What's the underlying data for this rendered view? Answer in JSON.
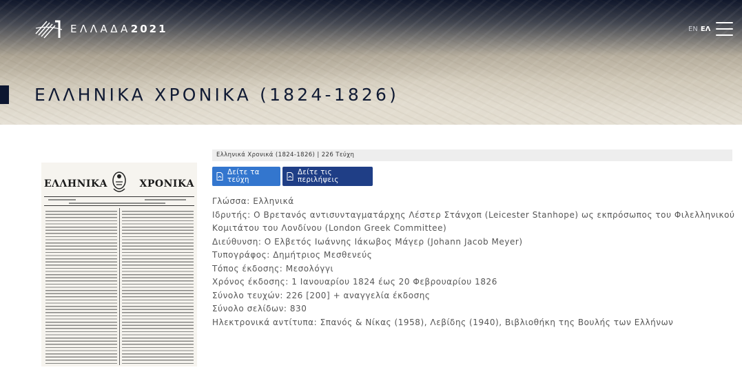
{
  "header": {
    "logo_text": "ΕΛΛΑΔΑ",
    "logo_year": "2021",
    "lang_en": "EN",
    "lang_el": "ΕΛ",
    "menu_icon": "hamburger-icon"
  },
  "page": {
    "title": "ΕΛΛΗΝΙΚΑ ΧΡΟΝΙΚΑ (1824-1826)"
  },
  "newspaper": {
    "masthead_left": "ΕΛΛΗΝΙΚΑ",
    "masthead_right": "ΧΡΟΝΙΚΑ",
    "emblem_icon": "crest-icon"
  },
  "breadcrumb": "Ελληνικά Χρονικά (1824-1826) | 226 Τεύχη",
  "buttons": {
    "issues": "Δείτε τα τεύχη",
    "summaries": "Δείτε τις περιλήψεις",
    "icon": "pdf-file-icon"
  },
  "details": [
    "Γλώσσα: Ελληνικά",
    "Ιδρυτής: Ο Βρετανός αντισυνταγματάρχης Λέστερ Στάνχοπ (Leicester Stanhope) ως εκπρόσωπος του Φιλελληνικού",
    "Κομιτάτου του Λονδίνου (London Greek Committee)",
    "Διεύθυνση: Ο Ελβετός Ιωάννης Ιάκωβος Μάγερ (Johann Jacob Meyer)",
    "Τυπογράφος: Δημήτριος Μεσθενεύς",
    "Τόπος έκδοσης: Μεσολόγγι",
    "Χρόνος έκδοσης: 1 Ιανουαρίου 1824 έως 20 Φεβρουαρίου 1826",
    "Σύνολο τευχών: 226 [200] + αναγγελία έκδοσης",
    "Σύνολο σελίδων: 830",
    "Ηλεκτρονικά αντίτυπα: Σπανός & Νίκας (1958), Λεβίδης (1940), Βιβλιοθήκη της Βουλής των Ελλήνων"
  ],
  "colors": {
    "primary_button": "#3376ce",
    "secondary_button": "#1f3e86",
    "title": "#101a33"
  }
}
